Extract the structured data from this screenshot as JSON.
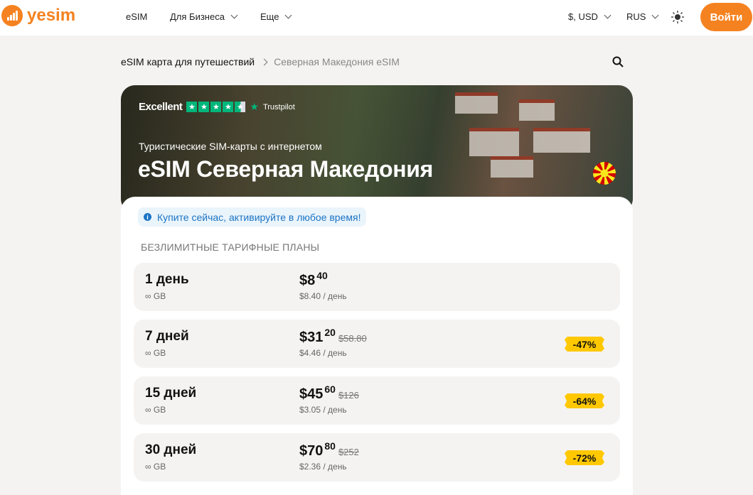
{
  "header": {
    "logo": "yesim",
    "nav": [
      {
        "label": "eSIM"
      },
      {
        "label": "Для Бизнеса"
      },
      {
        "label": "Еще"
      }
    ],
    "currency": "$, USD",
    "language": "RUS",
    "login": "Войти"
  },
  "breadcrumb": {
    "parent": "eSIM карта для путешествий",
    "current": "Северная Македония eSIM"
  },
  "hero": {
    "rating_label": "Excellent",
    "rating_stars": 4.5,
    "trustpilot": "Trustpilot",
    "subtitle": "Туристические SIM-карты с интернетом",
    "title": "eSIM Северная Македония"
  },
  "notice": "Купите сейчас, активируйте в любое время!",
  "section_title": "БЕЗЛИМИТНЫЕ ТАРИФНЫЕ ПЛАНЫ",
  "plans": [
    {
      "duration": "1 день",
      "data": "∞ GB",
      "price_main": "$8",
      "price_cents": "40",
      "old_price": "",
      "per_day": "$8.40 / день",
      "discount": ""
    },
    {
      "duration": "7 дней",
      "data": "∞ GB",
      "price_main": "$31",
      "price_cents": "20",
      "old_price": "$58.80",
      "per_day": "$4.46 / день",
      "discount": "-47%"
    },
    {
      "duration": "15 дней",
      "data": "∞ GB",
      "price_main": "$45",
      "price_cents": "60",
      "old_price": "$126",
      "per_day": "$3.05 / день",
      "discount": "-64%"
    },
    {
      "duration": "30 дней",
      "data": "∞ GB",
      "price_main": "$70",
      "price_cents": "80",
      "old_price": "$252",
      "per_day": "$2.36 / день",
      "discount": "-72%"
    }
  ]
}
